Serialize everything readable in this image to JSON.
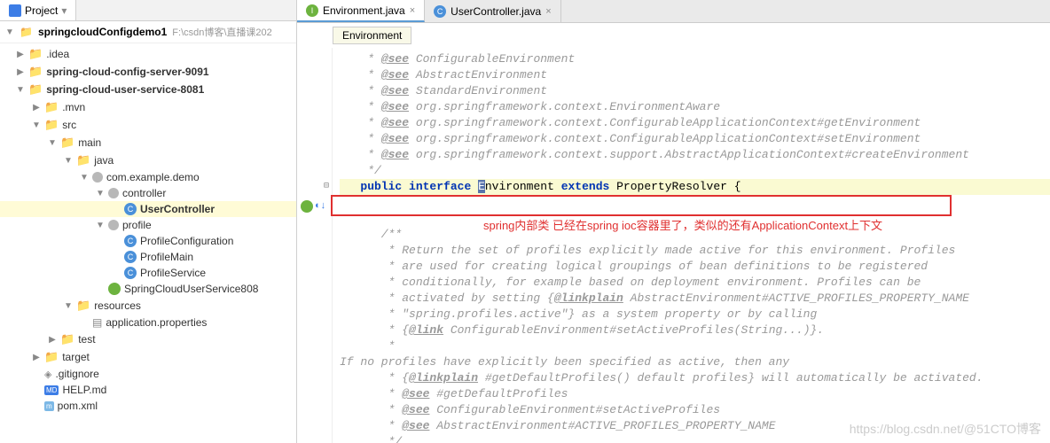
{
  "sidebar": {
    "tab": "Project",
    "root": {
      "name": "springcloudConfigdemo1",
      "path": "F:\\csdn博客\\直播课202"
    },
    "items": [
      {
        "arrow": "▶",
        "cls": "indent1",
        "icon": "folder-gray",
        "label": ".idea"
      },
      {
        "arrow": "▶",
        "cls": "indent1 bold",
        "icon": "folder",
        "label": "spring-cloud-config-server-9091"
      },
      {
        "arrow": "▼",
        "cls": "indent1 bold",
        "icon": "folder",
        "label": "spring-cloud-user-service-8081"
      },
      {
        "arrow": "▶",
        "cls": "indent2",
        "icon": "folder-gray",
        "label": ".mvn"
      },
      {
        "arrow": "▼",
        "cls": "indent2",
        "icon": "folder",
        "label": "src"
      },
      {
        "arrow": "▼",
        "cls": "indent3",
        "icon": "folder",
        "label": "main"
      },
      {
        "arrow": "▼",
        "cls": "indent4",
        "icon": "folder-blue",
        "label": "java"
      },
      {
        "arrow": "▼",
        "cls": "indent5",
        "icon": "pkg",
        "label": "com.example.demo"
      },
      {
        "arrow": "▼",
        "cls": "indent6",
        "icon": "pkg",
        "label": "controller"
      },
      {
        "arrow": "",
        "cls": "indent7",
        "icon": "class",
        "label": "UserController",
        "selected": true
      },
      {
        "arrow": "▼",
        "cls": "indent6",
        "icon": "pkg",
        "label": "profile"
      },
      {
        "arrow": "",
        "cls": "indent7",
        "icon": "class",
        "label": "ProfileConfiguration"
      },
      {
        "arrow": "",
        "cls": "indent7",
        "icon": "class",
        "label": "ProfileMain"
      },
      {
        "arrow": "",
        "cls": "indent7",
        "icon": "class",
        "label": "ProfileService"
      },
      {
        "arrow": "",
        "cls": "indent6",
        "icon": "spring",
        "label": "SpringCloudUserService808"
      },
      {
        "arrow": "▼",
        "cls": "indent4",
        "icon": "res",
        "label": "resources"
      },
      {
        "arrow": "",
        "cls": "indent5",
        "icon": "file",
        "label": "application.properties"
      },
      {
        "arrow": "▶",
        "cls": "indent3",
        "icon": "folder",
        "label": "test"
      },
      {
        "arrow": "▶",
        "cls": "indent2",
        "icon": "folder-orange",
        "label": "target"
      },
      {
        "arrow": "",
        "cls": "indent2",
        "icon": "git",
        "label": ".gitignore"
      },
      {
        "arrow": "",
        "cls": "indent2",
        "icon": "md",
        "label": "HELP.md"
      },
      {
        "arrow": "",
        "cls": "indent2",
        "icon": "xml",
        "label": "pom.xml"
      }
    ]
  },
  "editor": {
    "tabs": [
      {
        "label": "Environment.java",
        "icon": "interface",
        "active": true
      },
      {
        "label": "UserController.java",
        "icon": "class",
        "active": false
      }
    ],
    "breadcrumb": "Environment",
    "annotation": "spring内部类 已经在spring ioc容器里了，类似的还有ApplicationContext上下文",
    "decl": {
      "kw1": "public",
      "kw2": "interface",
      "name": "Environment",
      "kw3": "extends",
      "super": "PropertyResolver",
      "brace": "{"
    },
    "comments1": [
      " * @see ConfigurableEnvironment",
      " * @see AbstractEnvironment",
      " * @see StandardEnvironment",
      " * @see org.springframework.context.EnvironmentAware",
      " * @see org.springframework.context.ConfigurableApplicationContext#getEnvironment",
      " * @see org.springframework.context.ConfigurableApplicationContext#setEnvironment",
      " * @see org.springframework.context.support.AbstractApplicationContext#createEnvironment",
      " */"
    ],
    "comments2": [
      "/**",
      " * Return the set of profiles explicitly made active for this environment. Profiles",
      " * are used for creating logical groupings of bean definitions to be registered",
      " * conditionally, for example based on deployment environment. Profiles can be",
      " * activated by setting {@linkplain AbstractEnvironment#ACTIVE_PROFILES_PROPERTY_NAME",
      " * \"spring.profiles.active\"} as a system property or by calling",
      " * {@link ConfigurableEnvironment#setActiveProfiles(String...)}.",
      " * <p>If no profiles have explicitly been specified as active, then any",
      " * {@linkplain #getDefaultProfiles() default profiles} will automatically be activated.",
      " * @see #getDefaultProfiles",
      " * @see ConfigurableEnvironment#setActiveProfiles",
      " * @see AbstractEnvironment#ACTIVE_PROFILES_PROPERTY_NAME",
      " */"
    ]
  },
  "watermark": "https://blog.csdn.net/@51CTO博客"
}
